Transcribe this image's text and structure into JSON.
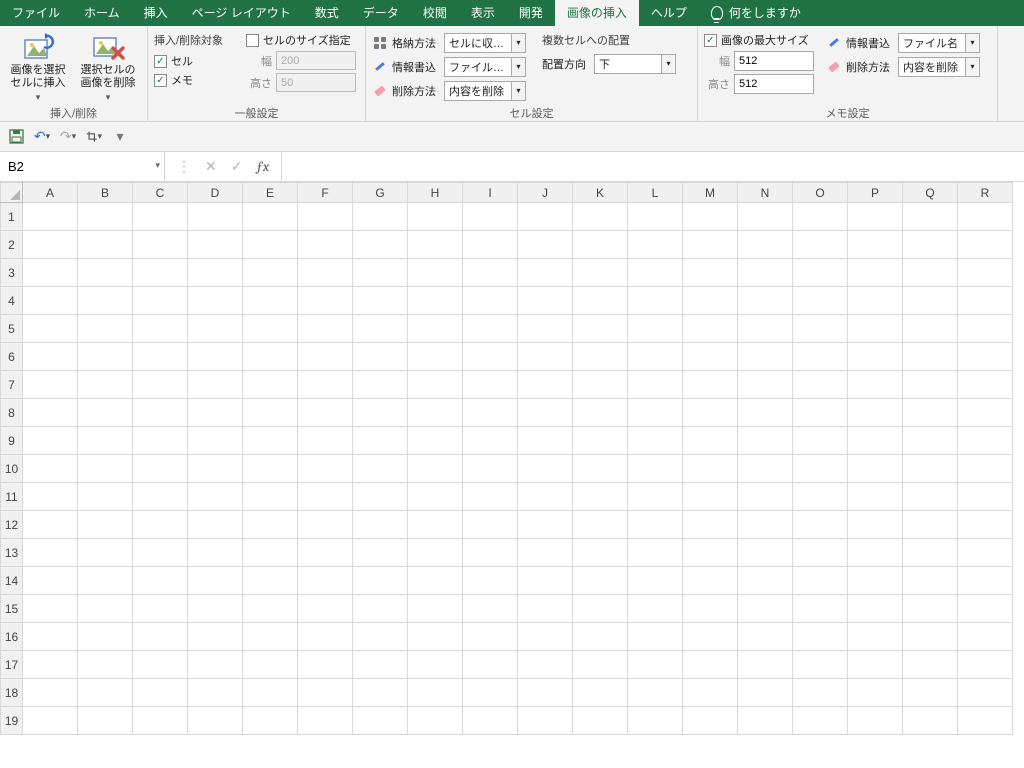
{
  "tabs": {
    "items": [
      "ファイル",
      "ホーム",
      "挿入",
      "ページ レイアウト",
      "数式",
      "データ",
      "校閲",
      "表示",
      "開発",
      "画像の挿入",
      "ヘルプ"
    ],
    "active_index": 9,
    "tell_me": "何をしますか"
  },
  "ribbon": {
    "insert_delete": {
      "label": "挿入/削除",
      "btn_insert": "画像を選択セルに挿入",
      "btn_delete": "選択セルの画像を削除"
    },
    "general": {
      "label": "一般設定",
      "title": "挿入/削除対象",
      "chk_cell": "セル",
      "chk_cell_on": true,
      "chk_memo": "メモ",
      "chk_memo_on": true,
      "size_title": "セルのサイズ指定",
      "size_on": false,
      "width_label": "幅",
      "width_value": "200",
      "height_label": "高さ",
      "height_value": "50"
    },
    "cell": {
      "label": "セル設定",
      "storage_label": "格納方法",
      "storage_value": "セルに収める",
      "write_label": "情報書込",
      "write_value": "ファイルパス…",
      "del_label": "削除方法",
      "del_value": "内容を削除",
      "multi_title": "複数セルへの配置",
      "dir_label": "配置方向",
      "dir_value": "下"
    },
    "memo": {
      "label": "メモ設定",
      "max_title": "画像の最大サイズ",
      "max_on": true,
      "width_label": "幅",
      "width_value": "512",
      "height_label": "高さ",
      "height_value": "512",
      "write_label": "情報書込",
      "write_value": "ファイル名",
      "del_label": "削除方法",
      "del_value": "内容を削除"
    }
  },
  "namebox": "B2",
  "formula": "",
  "columns": [
    "A",
    "B",
    "C",
    "D",
    "E",
    "F",
    "G",
    "H",
    "I",
    "J",
    "K",
    "L",
    "M",
    "N",
    "O",
    "P",
    "Q",
    "R"
  ],
  "rows": [
    1,
    2,
    3,
    4,
    5,
    6,
    7,
    8,
    9,
    10,
    11,
    12,
    13,
    14,
    15,
    16,
    17,
    18,
    19
  ]
}
